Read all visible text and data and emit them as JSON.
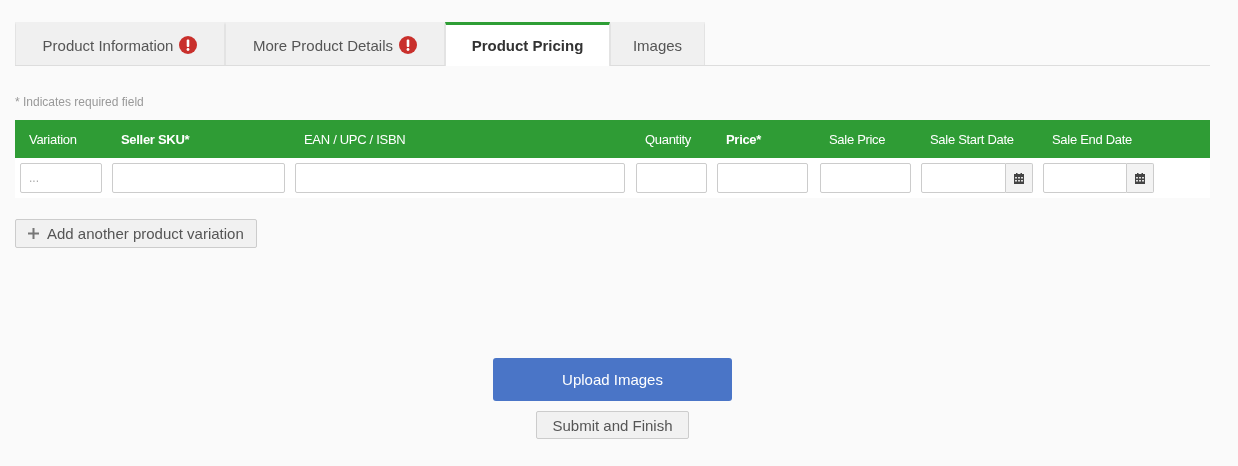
{
  "tabs": [
    {
      "label": "Product Information",
      "alert": true,
      "selected": false
    },
    {
      "label": "More Product Details",
      "alert": true,
      "selected": false
    },
    {
      "label": "Product Pricing",
      "alert": false,
      "selected": true
    },
    {
      "label": "Images",
      "alert": false,
      "selected": false
    }
  ],
  "required_note": "* Indicates required field",
  "table": {
    "columns": [
      {
        "label": "Variation",
        "required": false,
        "kind": "text",
        "placeholder": "..."
      },
      {
        "label": "Seller SKU*",
        "required": true,
        "kind": "text"
      },
      {
        "label": "EAN / UPC / ISBN",
        "required": false,
        "kind": "text"
      },
      {
        "label": "Quantity",
        "required": false,
        "kind": "text"
      },
      {
        "label": "Price*",
        "required": true,
        "kind": "text"
      },
      {
        "label": "Sale Price",
        "required": false,
        "kind": "text"
      },
      {
        "label": "Sale Start Date",
        "required": false,
        "kind": "date"
      },
      {
        "label": "Sale End Date",
        "required": false,
        "kind": "date"
      }
    ]
  },
  "add_variation_button": "Add another product variation",
  "upload_button": "Upload Images",
  "submit_button": "Submit and Finish"
}
